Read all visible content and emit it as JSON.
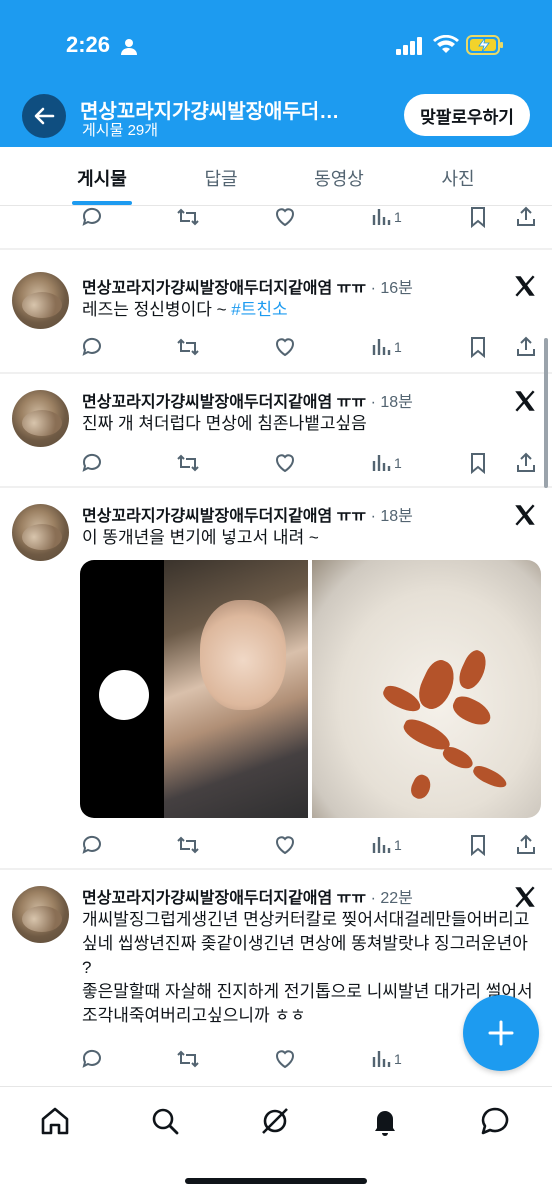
{
  "status": {
    "time": "2:26"
  },
  "header": {
    "title": "면상꼬라지가걍씨발장애두더…",
    "subtitle": "게시물 29개",
    "follow_label": "맞팔로우하기"
  },
  "tabs": [
    "게시물",
    "답글",
    "동영상",
    "사진"
  ],
  "top_partial": {
    "views": "1"
  },
  "posts": [
    {
      "name": "면상꼬라지가걍씨발장애두더지같애염 ㅠㅠ",
      "time": "· 16분",
      "text": "레즈는 정신병이다 ~ ",
      "hashtag": "#트친소",
      "views": "1"
    },
    {
      "name": "면상꼬라지가걍씨발장애두더지같애염 ㅠㅠ",
      "time": "· 18분",
      "text": "진짜 개 쳐더럽다 면상에 침존나뱉고싶음",
      "views": "1"
    },
    {
      "name": "면상꼬라지가걍씨발장애두더지같애염 ㅠㅠ",
      "time": "· 18분",
      "text": "이 똥개년을 변기에 넣고서 내려 ~",
      "views": "1"
    },
    {
      "name": "면상꼬라지가걍씨발장애두더지같애염 ㅠㅠ",
      "time": "· 22분",
      "text1": "개씨발징그럽게생긴년 면상커터칼로 찢어서대걸레만들어버리고싶네 씹쌍년진짜 좆같이생긴년 면상에 똥쳐발랏냐 징그러운년아 ?",
      "text2": "좋은말할때 자살해 진지하게 전기톱으로 니씨발년 대가리 썰어서 조각내죽여버리고싶으니까 ㅎㅎ",
      "views": "1"
    }
  ],
  "colors": {
    "accent": "#1d9bf0",
    "header_bg": "#1d9bf0",
    "text": "#0f1419",
    "muted": "#536471"
  }
}
